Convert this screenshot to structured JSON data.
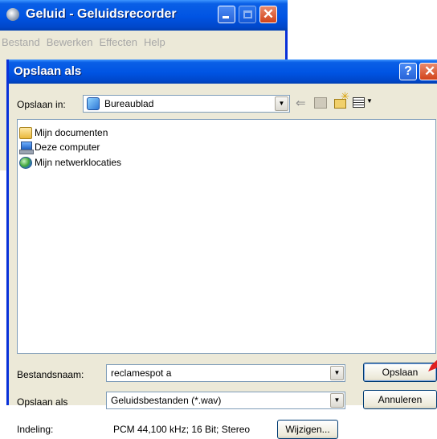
{
  "background_window": {
    "title": "Geluid - Geluidsrecorder",
    "menu": [
      "Bestand",
      "Bewerken",
      "Effecten",
      "Help"
    ]
  },
  "dialog": {
    "title": "Opslaan als",
    "help_glyph": "?",
    "lookin_label": "Opslaan in:",
    "lookin_value": "Bureaublad",
    "files": [
      {
        "label": "Mijn documenten",
        "icon": "my-documents-icon"
      },
      {
        "label": "Deze computer",
        "icon": "my-computer-icon"
      },
      {
        "label": "Mijn netwerklocaties",
        "icon": "network-places-icon"
      }
    ],
    "filename_label": "Bestandsnaam:",
    "filename_value": "reclamespot a",
    "savetype_label": "Opslaan als",
    "savetype_value": "Geluidsbestanden (*.wav)",
    "format_label": "Indeling:",
    "format_value": "PCM 44,100 kHz; 16 Bit; Stereo",
    "save_button": "Opslaan",
    "cancel_button": "Annuleren",
    "change_button": "Wijzigen..."
  },
  "colors": {
    "title_bar": "#0054e3",
    "dialog_face": "#ece9d8",
    "pointer_arrow": "#e02020"
  }
}
